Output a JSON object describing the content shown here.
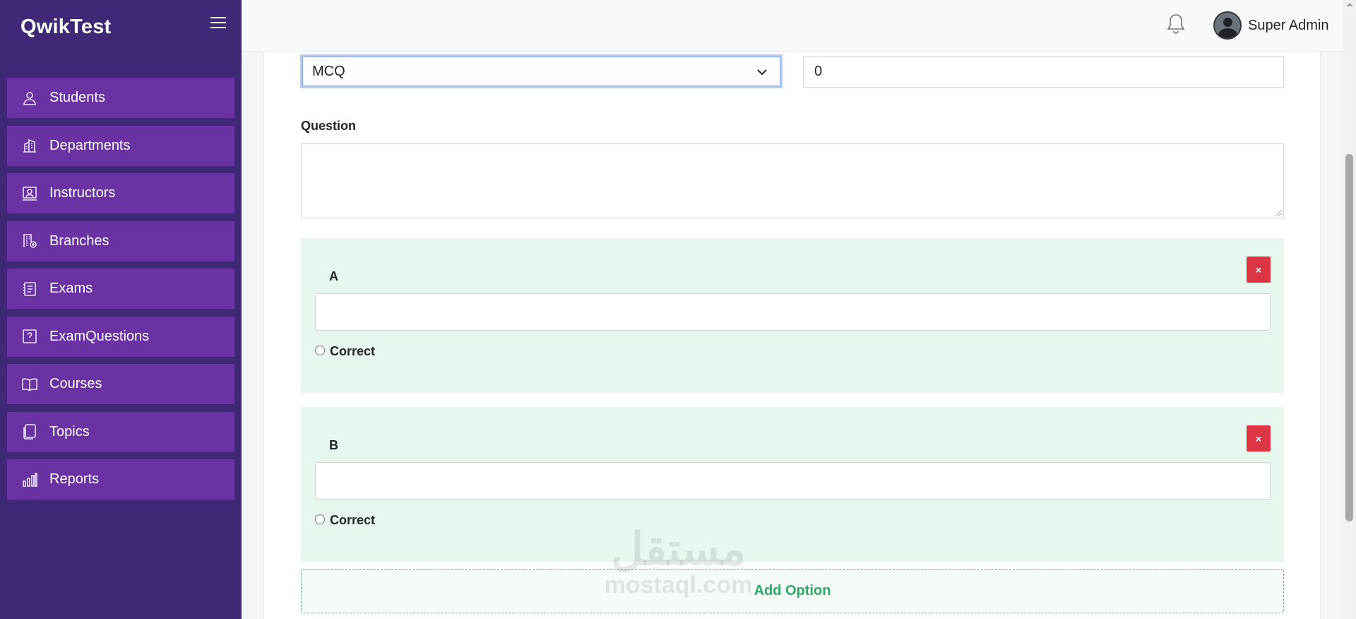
{
  "app": {
    "brand": "QwikTest"
  },
  "sidebar": {
    "items": [
      {
        "label": "Students",
        "icon": "user-icon"
      },
      {
        "label": "Departments",
        "icon": "buildings-icon"
      },
      {
        "label": "Instructors",
        "icon": "instructor-icon"
      },
      {
        "label": "Branches",
        "icon": "branch-icon"
      },
      {
        "label": "Exams",
        "icon": "exam-list-icon"
      },
      {
        "label": "ExamQuestions",
        "icon": "question-icon"
      },
      {
        "label": "Courses",
        "icon": "book-icon"
      },
      {
        "label": "Topics",
        "icon": "notebook-icon"
      },
      {
        "label": "Reports",
        "icon": "bar-chart-icon"
      }
    ]
  },
  "header": {
    "user_name": "Super Admin"
  },
  "form": {
    "question_type": "MCQ",
    "marks_value": "0",
    "question_label": "Question",
    "question_value": "",
    "options": [
      {
        "letter": "A",
        "value": "",
        "correct_label": "Correct",
        "remove_label": "×"
      },
      {
        "letter": "B",
        "value": "",
        "correct_label": "Correct",
        "remove_label": "×"
      }
    ],
    "add_option_label": "Add Option"
  },
  "watermark": {
    "arabic": "مستقل",
    "latin": "mostaql.com"
  },
  "colors": {
    "sidebar_bg": "#3f2875",
    "nav_item_bg": "#6a32a2",
    "option_bg": "#e7f7ee",
    "danger": "#dc3545",
    "success": "#2fa866"
  }
}
